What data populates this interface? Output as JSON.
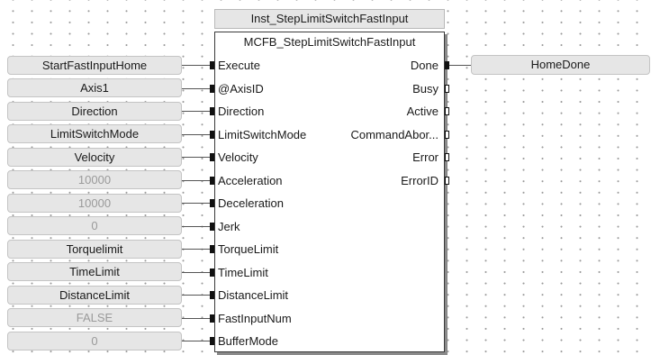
{
  "instance_name": "Inst_StepLimitSwitchFastInput",
  "fb_type": "MCFB_StepLimitSwitchFastInput",
  "inputs": [
    {
      "pin": "Execute",
      "var": "StartFastInputHome",
      "dim": false
    },
    {
      "pin": "@AxisID",
      "var": "Axis1",
      "dim": false
    },
    {
      "pin": "Direction",
      "var": "Direction",
      "dim": false
    },
    {
      "pin": "LimitSwitchMode",
      "var": "LimitSwitchMode",
      "dim": false
    },
    {
      "pin": "Velocity",
      "var": "Velocity",
      "dim": false
    },
    {
      "pin": "Acceleration",
      "var": "10000",
      "dim": true
    },
    {
      "pin": "Deceleration",
      "var": "10000",
      "dim": true
    },
    {
      "pin": "Jerk",
      "var": "0",
      "dim": true
    },
    {
      "pin": "TorqueLimit",
      "var": "Torquelimit",
      "dim": false
    },
    {
      "pin": "TimeLimit",
      "var": "TimeLimit",
      "dim": false
    },
    {
      "pin": "DistanceLimit",
      "var": "DistanceLimit",
      "dim": false
    },
    {
      "pin": "FastInputNum",
      "var": "FALSE",
      "dim": true
    },
    {
      "pin": "BufferMode",
      "var": "0",
      "dim": true
    }
  ],
  "outputs": [
    {
      "pin": "Done",
      "var": "HomeDone",
      "connected": true
    },
    {
      "pin": "Busy",
      "connected": false
    },
    {
      "pin": "Active",
      "connected": false
    },
    {
      "pin": "CommandAbor...",
      "connected": false
    },
    {
      "pin": "Error",
      "connected": false
    },
    {
      "pin": "ErrorID",
      "connected": false
    }
  ]
}
